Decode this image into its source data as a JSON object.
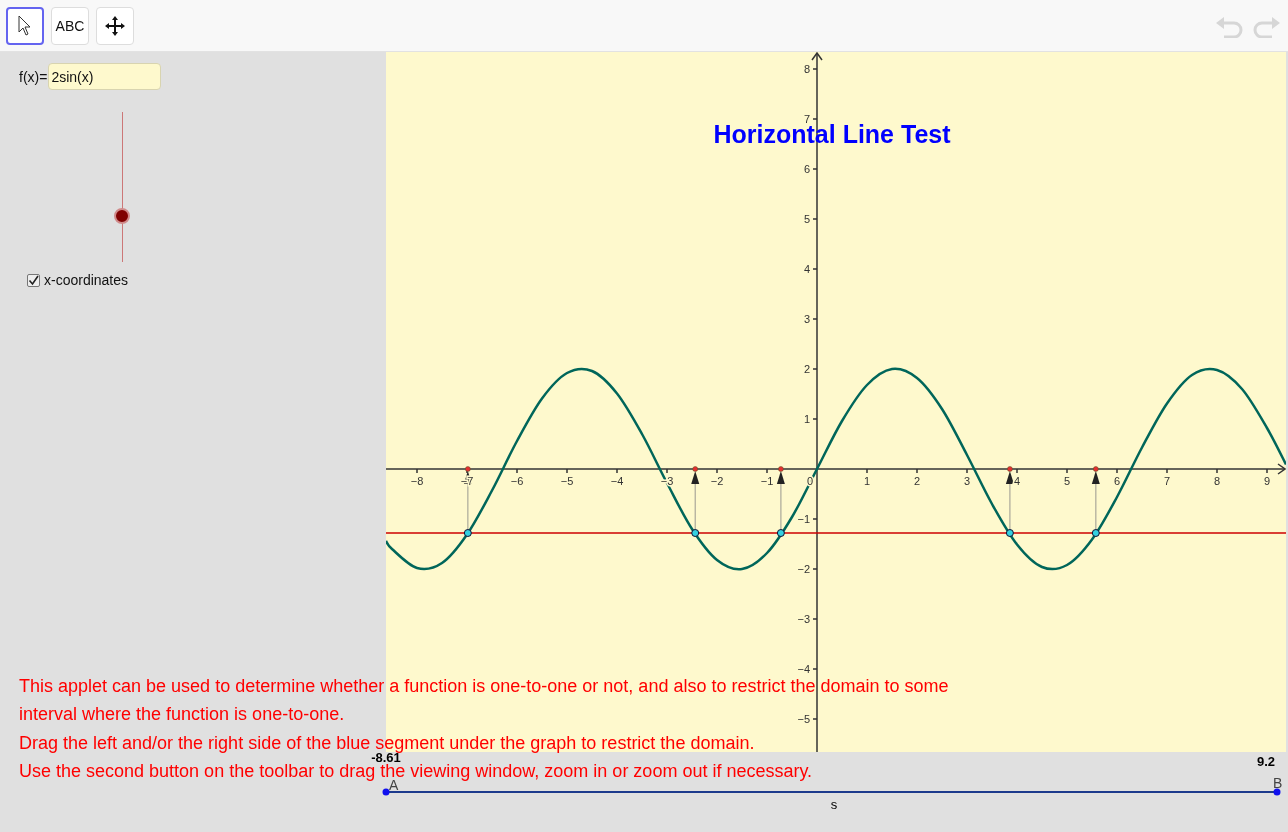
{
  "toolbar": {
    "tools": [
      {
        "kind": "pointer",
        "selected": true
      },
      {
        "kind": "text",
        "label": "ABC",
        "selected": false
      },
      {
        "kind": "move",
        "selected": false
      }
    ],
    "undo": {
      "disabled": true
    },
    "redo": {
      "disabled": true
    }
  },
  "function_input": {
    "label": "f(x)=",
    "value": "2sin(x)"
  },
  "slider": {
    "level": 0.31
  },
  "checkbox": {
    "label": "x-coordinates",
    "checked": true
  },
  "graph": {
    "chart_data": {
      "type": "line",
      "title": "Horizontal Line Test",
      "x": [
        -8.62,
        -8.5,
        -8,
        -7.5,
        -7,
        -6.5,
        -6,
        -5.5,
        -5,
        -4.5,
        -4,
        -3.5,
        -3,
        -2.5,
        -2,
        -1.5,
        -1,
        -0.5,
        0,
        0.5,
        1,
        1.5,
        2,
        2.5,
        3,
        3.5,
        4,
        4.5,
        5,
        5.5,
        6,
        6.5,
        7,
        7.5,
        8,
        8.5,
        9,
        9.38
      ],
      "series": [
        {
          "color": "#00665a",
          "values": [
            -1.44,
            -1.6,
            -1.98,
            -1.88,
            -1.31,
            -0.43,
            0.56,
            1.41,
            1.92,
            1.96,
            1.51,
            0.7,
            -0.28,
            -1.2,
            -1.82,
            -2.0,
            -1.68,
            -0.96,
            0,
            0.96,
            1.68,
            2.0,
            1.82,
            1.2,
            0.28,
            -0.7,
            -1.51,
            -1.96,
            -1.92,
            -1.41,
            -0.56,
            0.43,
            1.31,
            1.88,
            1.98,
            1.6,
            0.82,
            0.09
          ]
        },
        {
          "color": "#cc0000",
          "values": [
            -1.28,
            -1.28,
            -1.28,
            -1.28,
            -1.28,
            -1.28,
            -1.28,
            -1.28,
            -1.28,
            -1.28,
            -1.28,
            -1.28,
            -1.28,
            -1.28,
            -1.28,
            -1.28,
            -1.28,
            -1.28,
            -1.28,
            -1.28,
            -1.28,
            -1.28,
            -1.28,
            -1.28,
            -1.28,
            -1.28,
            -1.28,
            -1.28,
            -1.28,
            -1.28,
            -1.28,
            -1.28,
            -1.28,
            -1.28,
            -1.28,
            -1.28,
            -1.28,
            -1.28
          ]
        }
      ],
      "xlim": [
        -8.62,
        9.38
      ],
      "ylim": [
        -5.66,
        8.34
      ],
      "xticks": [
        {
          "value": -8,
          "label": "−8"
        },
        {
          "value": -7,
          "label": "−7"
        },
        {
          "value": -6,
          "label": "−6"
        },
        {
          "value": -5,
          "label": "−5"
        },
        {
          "value": -4,
          "label": "−4"
        },
        {
          "value": -3,
          "label": "−3"
        },
        {
          "value": -2,
          "label": "−2"
        },
        {
          "value": -1,
          "label": "−1"
        },
        1,
        2,
        3,
        4,
        5,
        6,
        7,
        8,
        9
      ],
      "yticks": [
        {
          "value": -5,
          "label": "−5"
        },
        {
          "value": -4,
          "label": "−4"
        },
        {
          "value": -3,
          "label": "−3"
        },
        {
          "value": -2,
          "label": "−2"
        },
        {
          "value": -1,
          "label": "−1"
        },
        1,
        2,
        3,
        4,
        5,
        6,
        7,
        8
      ]
    },
    "origin_label": "0"
  },
  "segment": {
    "name": "s",
    "start_label": "A",
    "end_label": "B",
    "start_value": "-8.61",
    "end_value": "9.2"
  },
  "instructions": [
    "This applet can be used to determine whether a function is one-to-one or not, and also to restrict the domain to some",
    "interval where the function is one-to-one.",
    "Drag the left and/or the right side of the blue segment under the graph to restrict the domain.",
    "Use the second button on the toolbar to drag the viewing window, zoom in or zoom out if necessary."
  ]
}
